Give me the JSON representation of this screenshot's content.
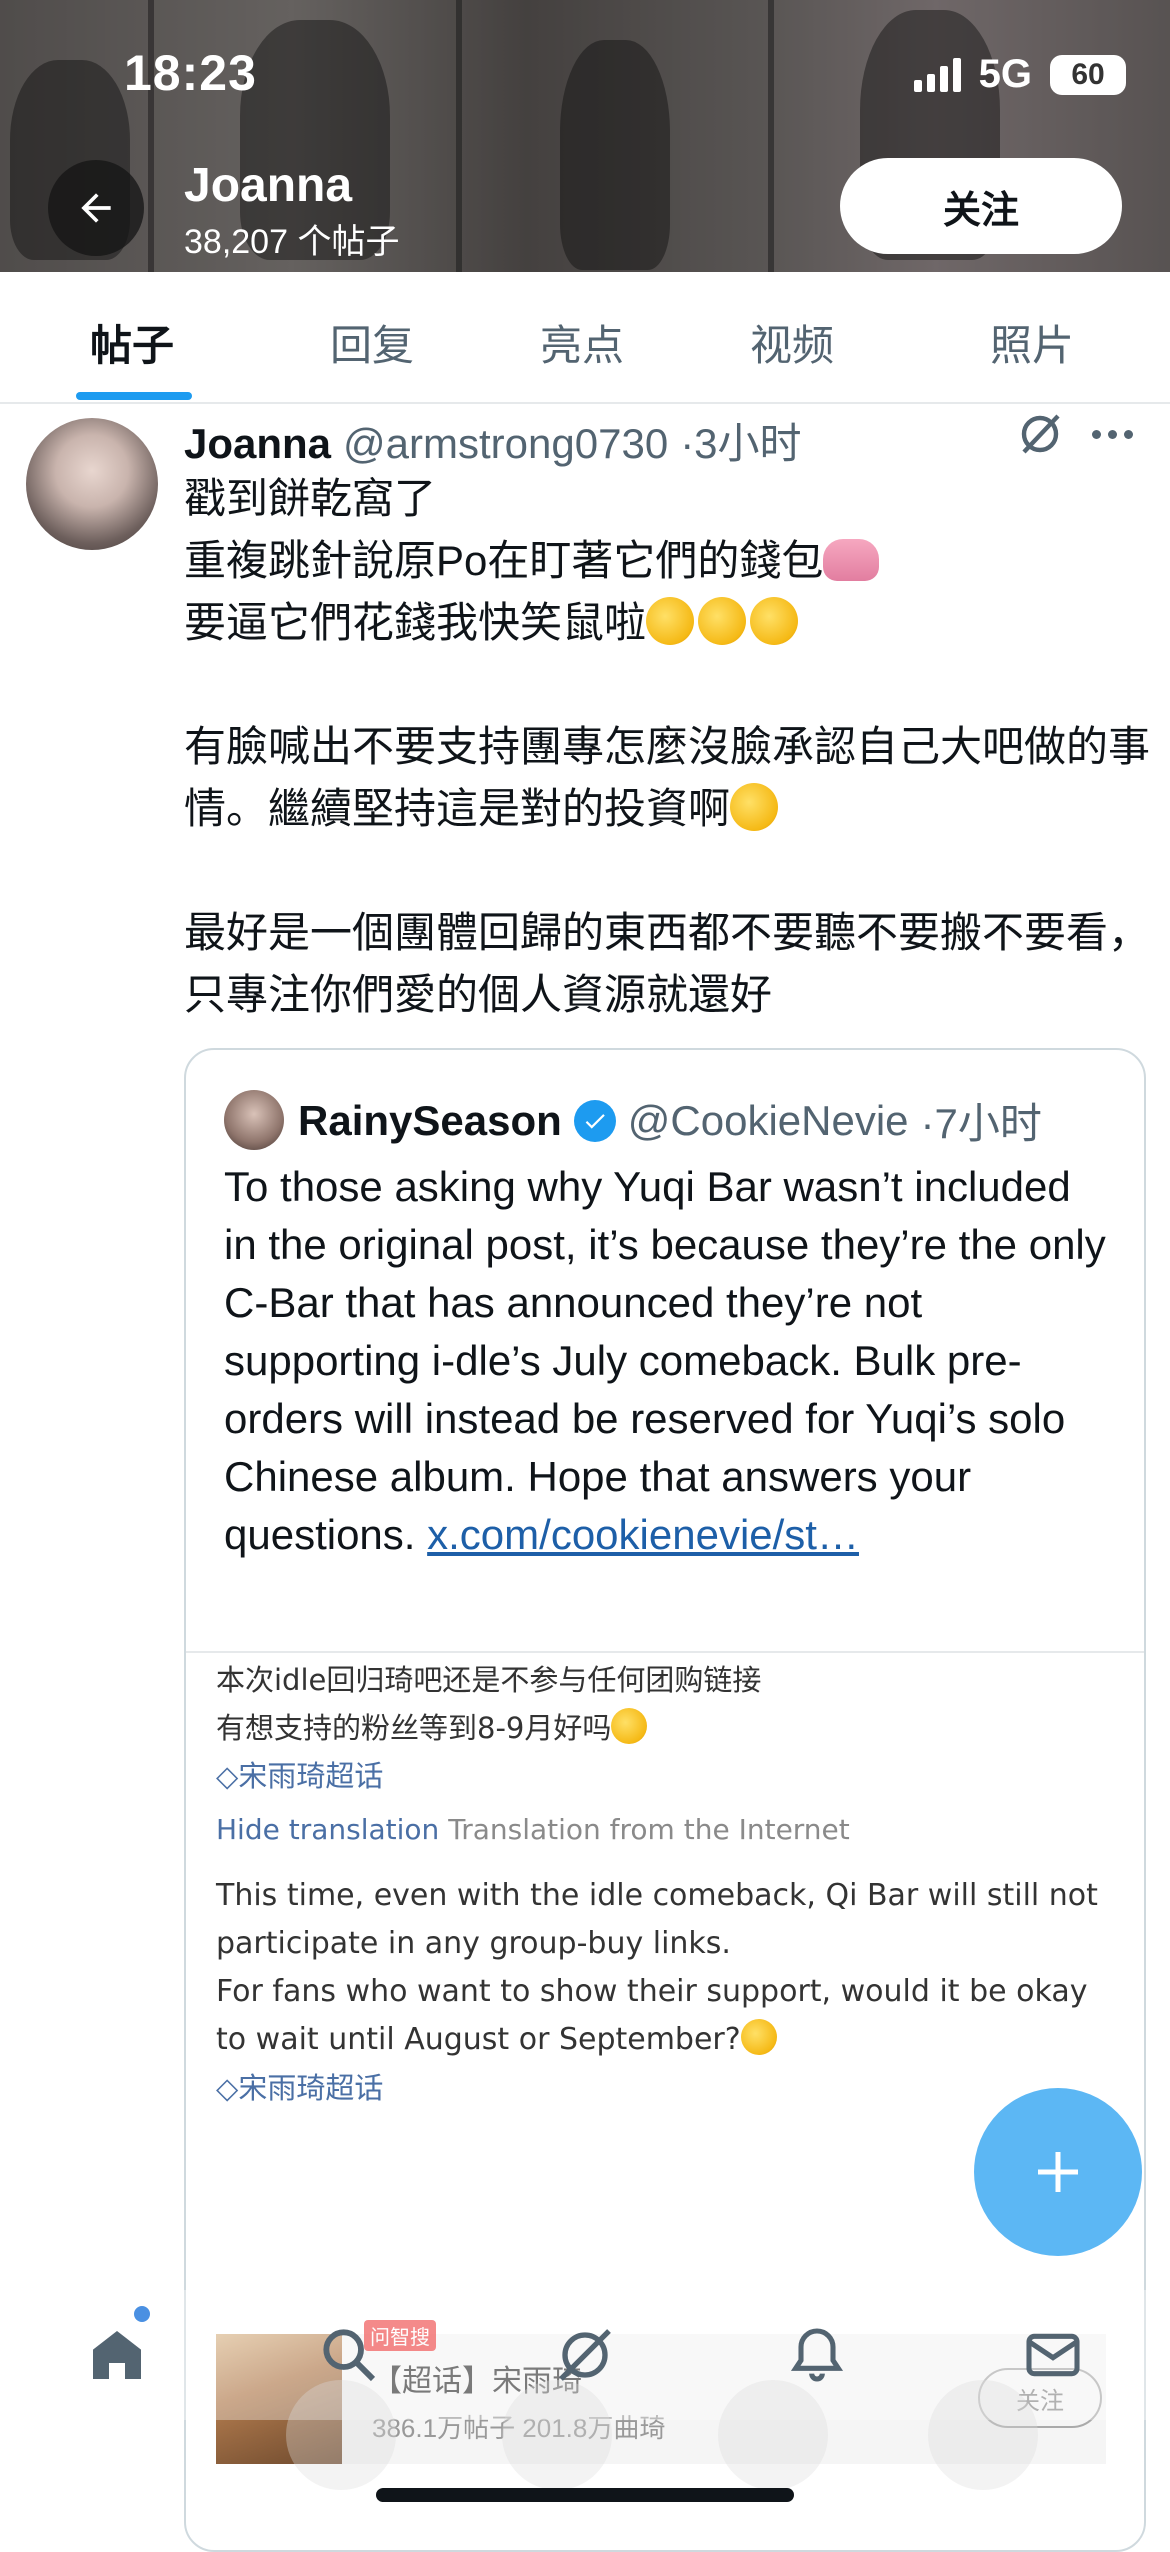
{
  "status_bar": {
    "time": "18:23",
    "network": "5G",
    "battery": "60"
  },
  "profile_header": {
    "name": "Joanna",
    "post_count": "38,207 个帖子",
    "follow_label": "关注"
  },
  "tabs": [
    {
      "label": "帖子",
      "active": true
    },
    {
      "label": "回复",
      "active": false
    },
    {
      "label": "亮点",
      "active": false
    },
    {
      "label": "视频",
      "active": false
    },
    {
      "label": "照片",
      "active": false
    }
  ],
  "post": {
    "author": "Joanna",
    "handle": "@armstrong0730",
    "time": "·3小时",
    "lines": [
      "戳到餅乾窩了",
      "重複跳針說原Po在盯著它們的錢包",
      "要逼它們花錢我快笑鼠啦"
    ],
    "paragraph2": "有臉喊出不要支持團專怎麼沒臉承認自己大吧做的事情。繼續堅持這是對的投資啊",
    "paragraph3": "最好是一個團體回歸的東西都不要聽不要搬不要看，只專注你們愛的個人資源就還好"
  },
  "quote": {
    "author": "RainySeason",
    "handle": "@CookieNevie",
    "time": "·7小时",
    "text": "To those asking why Yuqi Bar wasn’t included in the original post, it’s because they’re the only C-Bar that has announced they’re not supporting i-dle’s July comeback. Bulk pre-orders will instead be reserved for Yuqi’s solo Chinese album. Hope that answers your questions. ",
    "link": "x.com/cookienevie/st…"
  },
  "embedded": {
    "line1": "本次idle回归琦吧还是不参与任何团购链接",
    "line2": "有想支持的粉丝等到8-9月好吗",
    "tag": "宋雨琦超话",
    "hide_translation": "Hide translation",
    "translation_source": "Translation from the Internet",
    "en_line1": "This time, even with the idle comeback, Qi Bar will still not participate in any group-buy links.",
    "en_line2": "For fans who want to show their support, would it be okay to wait until August or September?",
    "tag2": "宋雨琦超话",
    "card_title": "【超话】宋雨琦",
    "card_sub": "386.1万帖子 201.8万曲琦",
    "card_follow": "关注",
    "search_badge": "问智搜"
  },
  "colors": {
    "accent": "#1d9bf0",
    "text": "#0f1419",
    "muted": "#536471",
    "link": "#1d5fa8"
  }
}
